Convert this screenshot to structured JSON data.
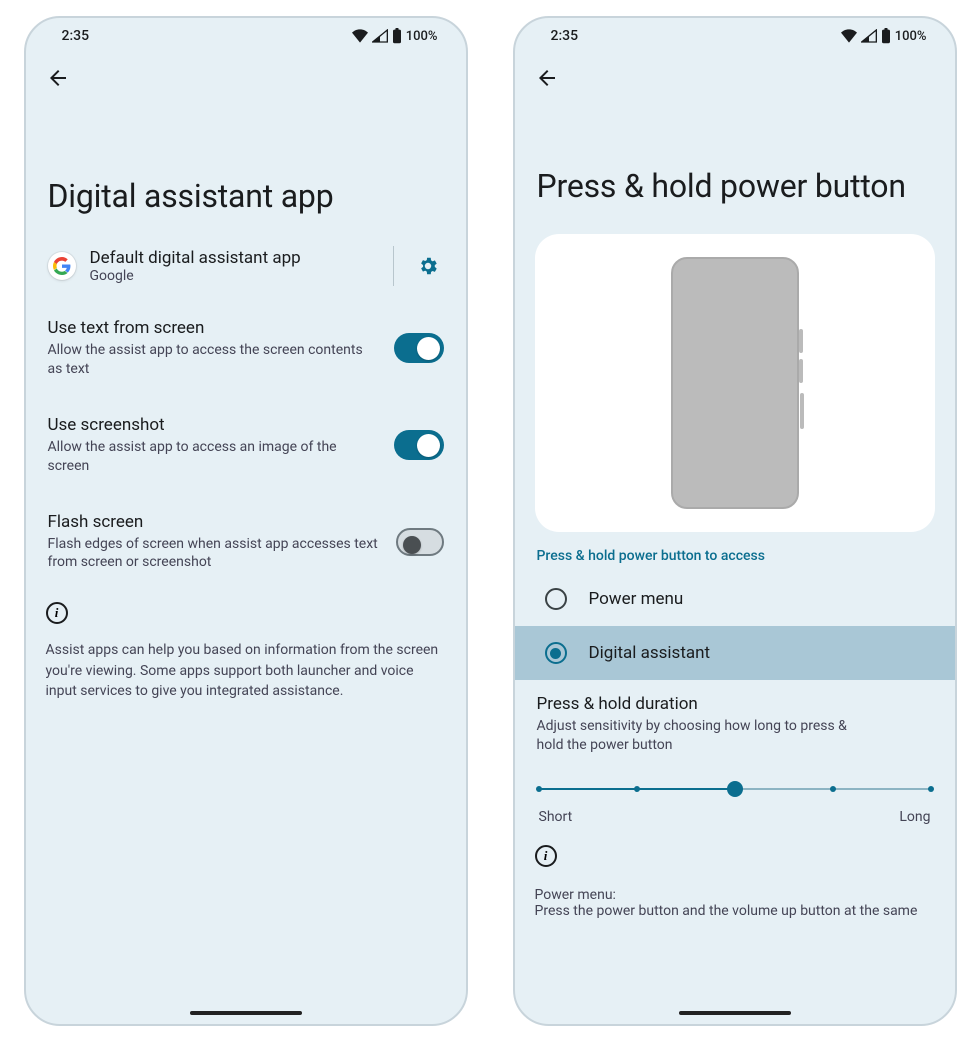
{
  "status": {
    "time": "2:35",
    "battery": "100%"
  },
  "left": {
    "title": "Digital assistant app",
    "default_app": {
      "title": "Default digital assistant app",
      "subtitle": "Google"
    },
    "toggles": [
      {
        "title": "Use text from screen",
        "subtitle": "Allow the assist app to access the screen contents as text",
        "on": true
      },
      {
        "title": "Use screenshot",
        "subtitle": "Allow the assist app to access an image of the screen",
        "on": true
      },
      {
        "title": "Flash screen",
        "subtitle": "Flash edges of screen when assist app accesses text from screen or screenshot",
        "on": false
      }
    ],
    "footer": "Assist apps can help you based on information from the screen you're viewing. Some apps support both launcher and voice input services to give you integrated assistance."
  },
  "right": {
    "title": "Press & hold power button",
    "section_header": "Press & hold power button to access",
    "options": [
      {
        "label": "Power menu",
        "selected": false
      },
      {
        "label": "Digital assistant",
        "selected": true
      }
    ],
    "duration": {
      "title": "Press & hold duration",
      "subtitle": "Adjust sensitivity by choosing how long to press & hold the power button",
      "label_left": "Short",
      "label_right": "Long",
      "value_percent": 50,
      "ticks": [
        0,
        25,
        50,
        75,
        100
      ]
    },
    "power_menu_header": "Power menu:",
    "power_menu_text": "Press the power button and the volume up button at the same"
  }
}
